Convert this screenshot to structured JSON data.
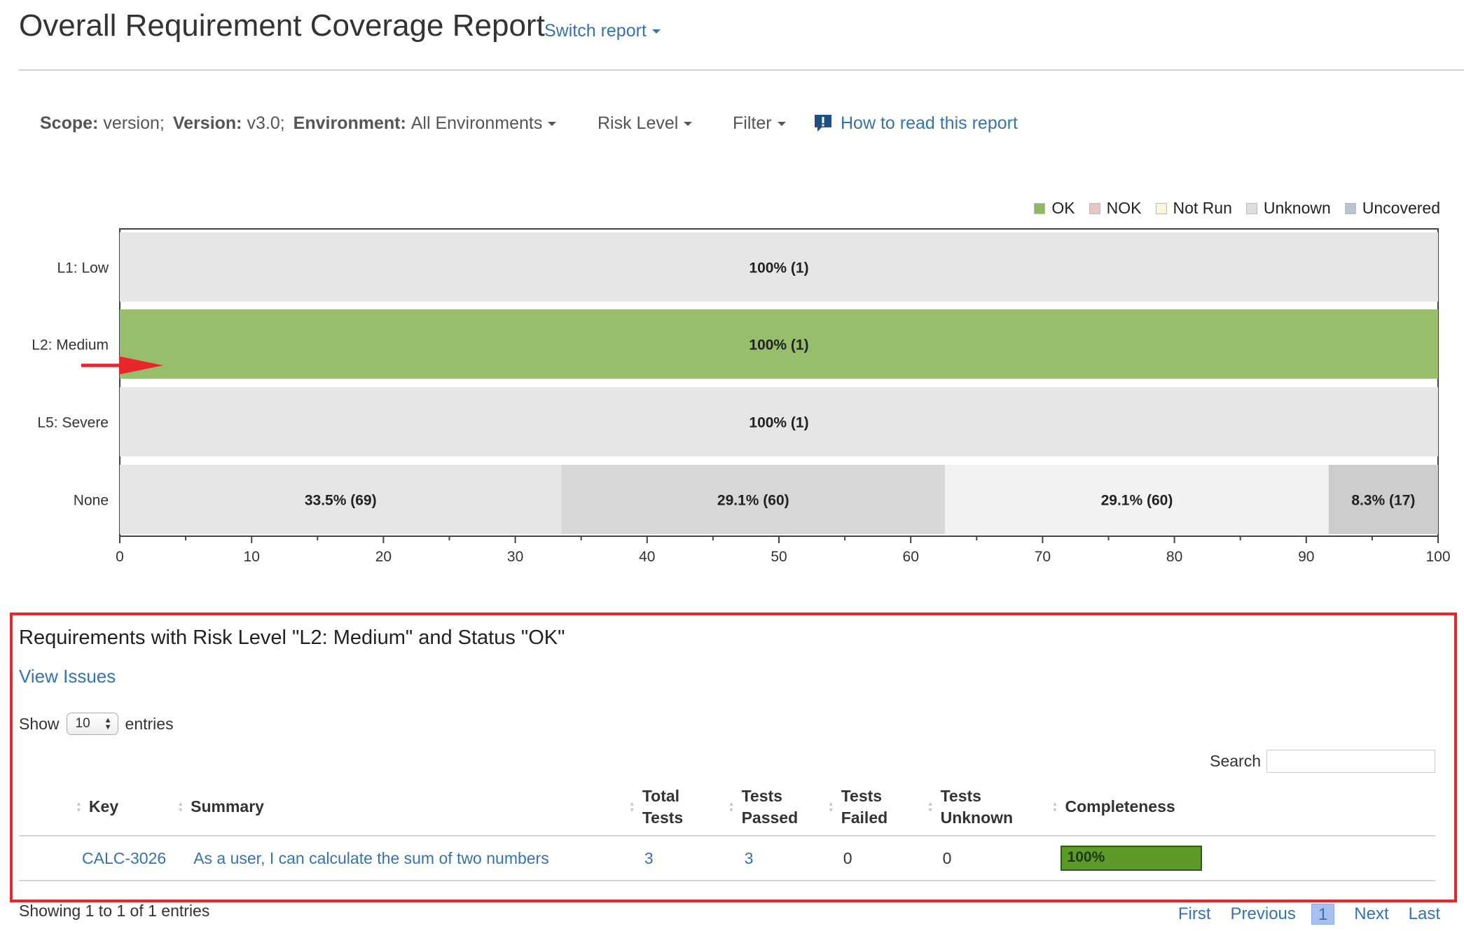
{
  "header": {
    "title": "Overall Requirement Coverage Report",
    "switch_report": "Switch report"
  },
  "scope_bar": {
    "scope_label": "Scope:",
    "scope_value": "version;",
    "version_label": "Version:",
    "version_value": "v3.0;",
    "environment_label": "Environment:",
    "environment_value": "All Environments",
    "risk_level": "Risk Level",
    "filter": "Filter",
    "how_to": "How to read this report"
  },
  "legend": [
    {
      "label": "OK",
      "color": "#8fb860"
    },
    {
      "label": "NOK",
      "color": "#e8c4c4"
    },
    {
      "label": "Not Run",
      "color": "#fbf6d8"
    },
    {
      "label": "Unknown",
      "color": "#dedede"
    },
    {
      "label": "Uncovered",
      "color": "#b9c7d4"
    }
  ],
  "chart_data": {
    "type": "bar",
    "orientation": "horizontal",
    "stacked": true,
    "categories": [
      "L1: Low",
      "L2: Medium",
      "L5: Severe",
      "None"
    ],
    "xlim": [
      0,
      100
    ],
    "x_ticks": [
      0,
      10,
      20,
      30,
      40,
      50,
      60,
      70,
      80,
      90,
      100
    ],
    "rows": [
      {
        "category": "L1: Low",
        "segments": [
          {
            "value": 100,
            "label": "100% (1)",
            "color": "#e6e6e6"
          }
        ]
      },
      {
        "category": "L2: Medium",
        "segments": [
          {
            "value": 100,
            "label": "100% (1)",
            "color": "#97bf6b"
          }
        ]
      },
      {
        "category": "L5: Severe",
        "segments": [
          {
            "value": 100,
            "label": "100% (1)",
            "color": "#e6e6e6"
          }
        ]
      },
      {
        "category": "None",
        "segments": [
          {
            "value": 33.5,
            "label": "33.5% (69)",
            "color": "#e6e6e6"
          },
          {
            "value": 29.1,
            "label": "29.1% (60)",
            "color": "#d7d7d7"
          },
          {
            "value": 29.1,
            "label": "29.1% (60)",
            "color": "#f2f2f2"
          },
          {
            "value": 8.3,
            "label": "8.3% (17)",
            "color": "#cdcdcd"
          }
        ]
      }
    ],
    "annotation": {
      "type": "arrow",
      "row": "L2: Medium",
      "color": "#e8262b"
    }
  },
  "drilldown": {
    "title": "Requirements with Risk Level \"L2: Medium\" and Status \"OK\"",
    "view_issues": "View Issues",
    "show_label": "Show",
    "entries_value": "10",
    "entries_label": "entries",
    "search_label": "Search",
    "columns": {
      "key": "Key",
      "summary": "Summary",
      "total_1": "Total",
      "total_2": "Tests",
      "passed_1": "Tests",
      "passed_2": "Passed",
      "failed_1": "Tests",
      "failed_2": "Failed",
      "unknown_1": "Tests",
      "unknown_2": "Unknown",
      "completeness": "Completeness"
    },
    "rows": [
      {
        "key": "CALC-3026",
        "summary": "As a user, I can calculate the sum of two numbers",
        "total": "3",
        "passed": "3",
        "failed": "0",
        "unknown": "0",
        "completeness": "100%",
        "completeness_value": 100
      }
    ],
    "showing": "Showing 1 to 1 of 1 entries",
    "pager": {
      "first": "First",
      "previous": "Previous",
      "current": "1",
      "next": "Next",
      "last": "Last"
    }
  }
}
